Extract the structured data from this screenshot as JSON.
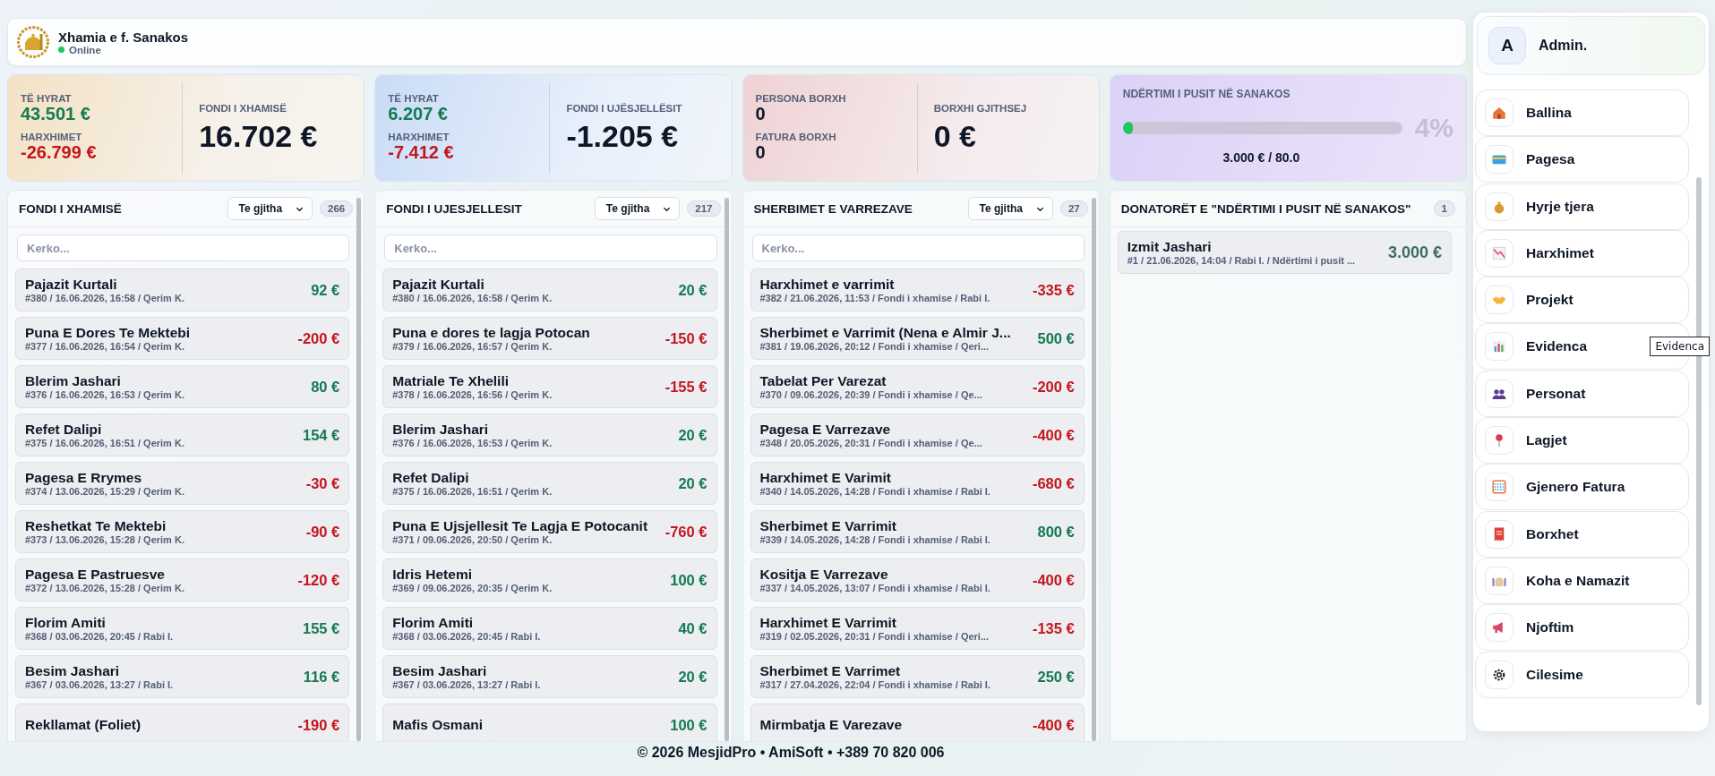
{
  "header": {
    "title": "Xhamia e f. Sanakos",
    "status": "Online",
    "online": true
  },
  "stats": [
    {
      "kind": "fund",
      "in_label": "TË HYRAT",
      "in_value": "43.501 €",
      "out_label": "HARXHIMET",
      "out_value": "-26.799 €",
      "total_label": "FONDI I XHAMISË",
      "total_value": "16.702 €"
    },
    {
      "kind": "fund",
      "in_label": "TË HYRAT",
      "in_value": "6.207 €",
      "out_label": "HARXHIMET",
      "out_value": "-7.412 €",
      "total_label": "FONDI I UJËSJELLËSIT",
      "total_value": "-1.205 €"
    },
    {
      "kind": "debt",
      "in_label": "PERSONA BORXH",
      "in_value": "0",
      "out_label": "FATURA BORXH",
      "out_value": "0",
      "total_label": "BORXHI GJITHSEJ",
      "total_value": "0 €"
    },
    {
      "kind": "project",
      "title": "NDËRTIMI I PUSIT NË SANAKOS",
      "level": 0.0375,
      "progress": "3.000 € / 80.0",
      "percent": "4%"
    }
  ],
  "columns": [
    {
      "title": "FONDI I XHAMISË",
      "filter": "Te gjitha",
      "count": "266",
      "placeholder": "Kerko...",
      "entries": [
        {
          "name": "Pajazit Kurtali",
          "meta": "#380 / 16.06.2026, 16:58 / Qerim K.",
          "amount": "92 €",
          "kind": "income"
        },
        {
          "name": "Puna E Dores Te Mektebi",
          "meta": "#377 / 16.06.2026, 16:54 / Qerim K.",
          "amount": "-200 €",
          "kind": "expense"
        },
        {
          "name": "Blerim Jashari",
          "meta": "#376 / 16.06.2026, 16:53 / Qerim K.",
          "amount": "80 €",
          "kind": "income"
        },
        {
          "name": "Refet Dalipi",
          "meta": "#375 / 16.06.2026, 16:51 / Qerim K.",
          "amount": "154 €",
          "kind": "income"
        },
        {
          "name": "Pagesa E Rrymes",
          "meta": "#374 / 13.06.2026, 15:29 / Qerim K.",
          "amount": "-30 €",
          "kind": "expense"
        },
        {
          "name": "Reshetkat Te Mektebi",
          "meta": "#373 / 13.06.2026, 15:28 / Qerim K.",
          "amount": "-90 €",
          "kind": "expense"
        },
        {
          "name": "Pagesa E Pastruesve",
          "meta": "#372 / 13.06.2026, 15:28 / Qerim K.",
          "amount": "-120 €",
          "kind": "expense"
        },
        {
          "name": "Florim Amiti",
          "meta": "#368 / 03.06.2026, 20:45 / Rabi I.",
          "amount": "155 €",
          "kind": "income"
        },
        {
          "name": "Besim Jashari",
          "meta": "#367 / 03.06.2026, 13:27 / Rabi I.",
          "amount": "116 €",
          "kind": "income"
        },
        {
          "name": "Rekllamat (Foliet)",
          "amount": "-190 €",
          "kind": "expense"
        }
      ]
    },
    {
      "title": "FONDI I UJESJELLESIT",
      "filter": "Te gjitha",
      "count": "217",
      "placeholder": "Kerko...",
      "entries": [
        {
          "name": "Pajazit Kurtali",
          "meta": "#380 / 16.06.2026, 16:58 / Qerim K.",
          "amount": "20 €",
          "kind": "income"
        },
        {
          "name": "Puna e dores te lagja Potocan",
          "meta": "#379 / 16.06.2026, 16:57 / Qerim K.",
          "amount": "-150 €",
          "kind": "expense"
        },
        {
          "name": "Matriale Te Xhelili",
          "meta": "#378 / 16.06.2026, 16:56 / Qerim K.",
          "amount": "-155 €",
          "kind": "expense"
        },
        {
          "name": "Blerim Jashari",
          "meta": "#376 / 16.06.2026, 16:53 / Qerim K.",
          "amount": "20 €",
          "kind": "income"
        },
        {
          "name": "Refet Dalipi",
          "meta": "#375 / 16.06.2026, 16:51 / Qerim K.",
          "amount": "20 €",
          "kind": "income"
        },
        {
          "name": "Puna E Ujsjellesit Te Lagja E Potocanit",
          "meta": "#371 / 09.06.2026, 20:50 / Qerim K.",
          "amount": "-760 €",
          "kind": "expense"
        },
        {
          "name": "Idris Hetemi",
          "meta": "#369 / 09.06.2026, 20:35 / Qerim K.",
          "amount": "100 €",
          "kind": "income"
        },
        {
          "name": "Florim Amiti",
          "meta": "#368 / 03.06.2026, 20:45 / Rabi I.",
          "amount": "40 €",
          "kind": "income"
        },
        {
          "name": "Besim Jashari",
          "meta": "#367 / 03.06.2026, 13:27 / Rabi I.",
          "amount": "20 €",
          "kind": "income"
        },
        {
          "name": "Mafis Osmani",
          "amount": "100 €",
          "kind": "income"
        }
      ]
    },
    {
      "title": "SHERBIMET E VARREZAVE",
      "filter": "Te gjitha",
      "count": "27",
      "placeholder": "Kerko...",
      "entries": [
        {
          "name": "Harxhimet e varrimit",
          "meta": "#382 / 21.06.2026, 11:53 / Fondi i xhamise / Rabi I.",
          "amount": "-335 €",
          "kind": "expense"
        },
        {
          "name": "Sherbimet e Varrimit (Nena e Almir J...",
          "meta": "#381 / 19.06.2026, 20:12 / Fondi i xhamise / Qeri...",
          "amount": "500 €",
          "kind": "income"
        },
        {
          "name": "Tabelat Per Varezat",
          "meta": "#370 / 09.06.2026, 20:39 / Fondi i xhamise / Qe...",
          "amount": "-200 €",
          "kind": "expense"
        },
        {
          "name": "Pagesa E Varrezave",
          "meta": "#348 / 20.05.2026, 20:31 / Fondi i xhamise / Qe...",
          "amount": "-400 €",
          "kind": "expense"
        },
        {
          "name": "Harxhimet E Varimit",
          "meta": "#340 / 14.05.2026, 14:28 / Fondi i xhamise / Rabi I.",
          "amount": "-680 €",
          "kind": "expense"
        },
        {
          "name": "Sherbimet E Varrimit",
          "meta": "#339 / 14.05.2026, 14:28 / Fondi i xhamise / Rabi I.",
          "amount": "800 €",
          "kind": "income"
        },
        {
          "name": "Kositja E Varrezave",
          "meta": "#337 / 14.05.2026, 13:07 / Fondi i xhamise / Rabi I.",
          "amount": "-400 €",
          "kind": "expense"
        },
        {
          "name": "Harxhimet E Varrimit",
          "meta": "#319 / 02.05.2026, 20:31 / Fondi i xhamise / Qeri...",
          "amount": "-135 €",
          "kind": "expense"
        },
        {
          "name": "Sherbimet E Varrimet",
          "meta": "#317 / 27.04.2026, 22:04 / Fondi i xhamise / Rabi I.",
          "amount": "250 €",
          "kind": "income"
        },
        {
          "name": "Mirmbatja E Varezave",
          "amount": "-400 €",
          "kind": "expense"
        }
      ]
    },
    {
      "title": "DONATORËT E \"NDËRTIMI I PUSIT NË SANAKOS\"",
      "count": "1",
      "entries": [
        {
          "name": "Izmit Jashari",
          "meta": "#1 / 21.06.2026, 14:04 / Rabi I. / Ndërtimi i pusit ...",
          "amount": "3.000 €",
          "kind": "donation"
        }
      ]
    }
  ],
  "sidebar": {
    "initial": "A",
    "user": "Admin.",
    "items": [
      {
        "label": "Ballina",
        "selected": false
      },
      {
        "label": "Pagesa",
        "selected": false
      },
      {
        "label": "Hyrje tjera",
        "selected": false
      },
      {
        "label": "Harxhimet",
        "selected": false
      },
      {
        "label": "Projekt",
        "selected": false
      },
      {
        "label": "Evidenca",
        "selected": false,
        "tooltip": "Evidenca"
      },
      {
        "label": "Personat",
        "selected": false
      },
      {
        "label": "Lagjet",
        "selected": false
      },
      {
        "label": "Gjenero Fatura",
        "selected": false
      },
      {
        "label": "Borxhet",
        "selected": false
      },
      {
        "label": "Koha e Namazit",
        "selected": false
      },
      {
        "label": "Njoftim",
        "selected": false
      },
      {
        "label": "Cilesime",
        "selected": false
      }
    ]
  },
  "footer": "© 2026 MesjidPro • AmiSoft • +389 70 820 006"
}
